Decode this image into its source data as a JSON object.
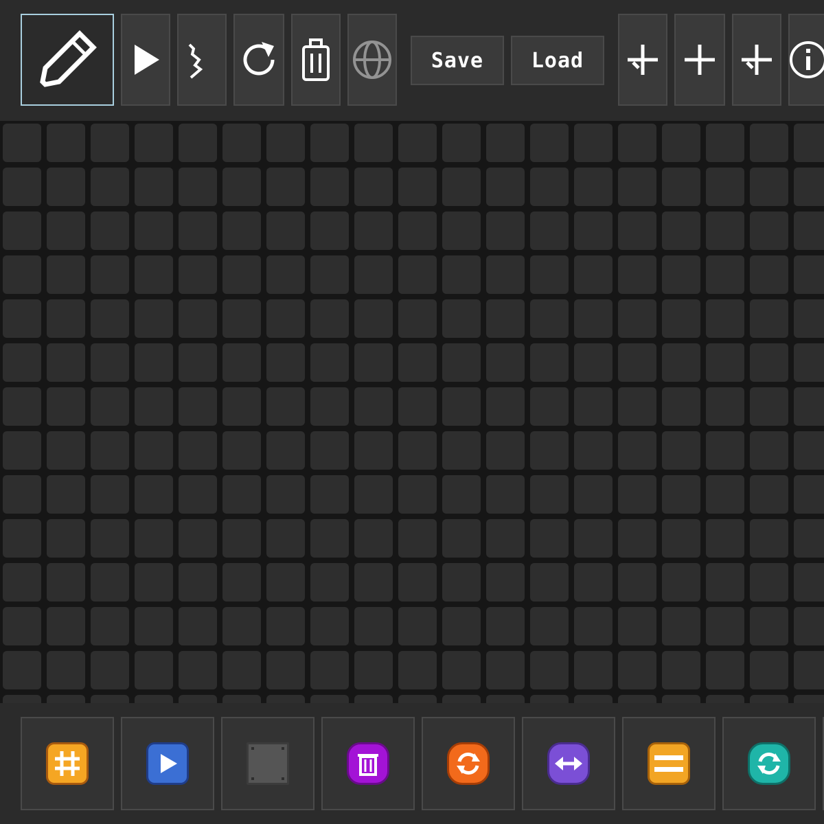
{
  "toolbar": {
    "tools": [
      {
        "id": "pencil",
        "icon": "pencil-icon",
        "selected": true
      },
      {
        "id": "play",
        "icon": "play-icon"
      },
      {
        "id": "step",
        "icon": "step-icon"
      },
      {
        "id": "reset",
        "icon": "reset-icon"
      },
      {
        "id": "clear",
        "icon": "trash-icon"
      },
      {
        "id": "web",
        "icon": "globe-icon",
        "dim": true
      }
    ],
    "save_label": "Save",
    "load_label": "Load",
    "extra": [
      {
        "id": "add-1",
        "icon": "plus-down-icon"
      },
      {
        "id": "add-2",
        "icon": "plus-icon"
      },
      {
        "id": "add-3",
        "icon": "plus-down-icon"
      },
      {
        "id": "info",
        "icon": "info-icon"
      }
    ]
  },
  "grid": {
    "cell_color": "#2e2e2e",
    "gap_color": "#161616"
  },
  "palette": [
    {
      "id": "grid-tile",
      "icon": "hash-icon",
      "color": "#f5a623"
    },
    {
      "id": "play-tile",
      "icon": "play-icon",
      "color": "#3b6fd4"
    },
    {
      "id": "wall-tile",
      "icon": "metal-block-icon",
      "color": "#555555"
    },
    {
      "id": "trash-tile",
      "icon": "trash-icon",
      "color": "#a313d6"
    },
    {
      "id": "rotate-tile",
      "icon": "rotate-icon",
      "color": "#f26a1b"
    },
    {
      "id": "swap-tile",
      "icon": "swap-horizontal-icon",
      "color": "#7b4fd6"
    },
    {
      "id": "bars-tile",
      "icon": "bars-icon",
      "color": "#f2a524"
    },
    {
      "id": "cycle-tile",
      "icon": "cycle-icon",
      "color": "#1fb5a8"
    }
  ]
}
